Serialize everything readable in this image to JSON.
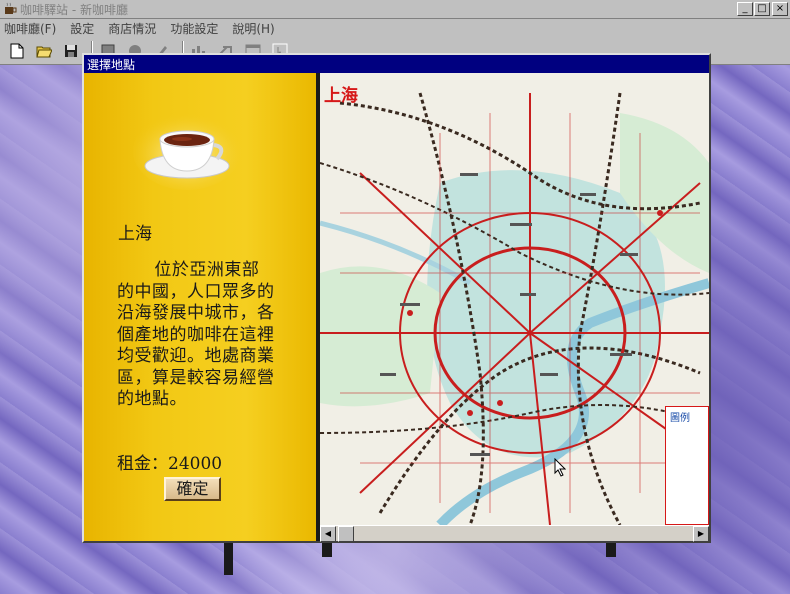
{
  "window": {
    "title": "咖啡驛站 - 新咖啡廳",
    "minimize_label": "_",
    "maximize_label": "□",
    "close_label": "×"
  },
  "menu": {
    "items": [
      "咖啡廳(F)",
      "設定",
      "商店情況",
      "功能設定",
      "說明(H)"
    ]
  },
  "toolbar": {
    "buttons": [
      "new-file",
      "open-folder",
      "save",
      "tool-4",
      "tool-5",
      "tool-6",
      "tool-7",
      "tool-8",
      "tool-9",
      "tool-10"
    ]
  },
  "dialog": {
    "title": "選擇地點",
    "city_name": "上海",
    "description": "位於亞洲東部的中國，人口眾多的沿海發展中城市，各個產地的咖啡在這裡均受歡迎。地處商業區，算是較容易經營的地點。",
    "rent_label": "租金：",
    "rent_value": "24000",
    "ok_label": "確定"
  },
  "map": {
    "label": "上海",
    "legend_title": "圖例"
  },
  "colors": {
    "title_bar": "#000080",
    "panel_yellow": "#f2c814",
    "map_road_red": "#c81e1e",
    "map_water": "#9fd3d8"
  }
}
